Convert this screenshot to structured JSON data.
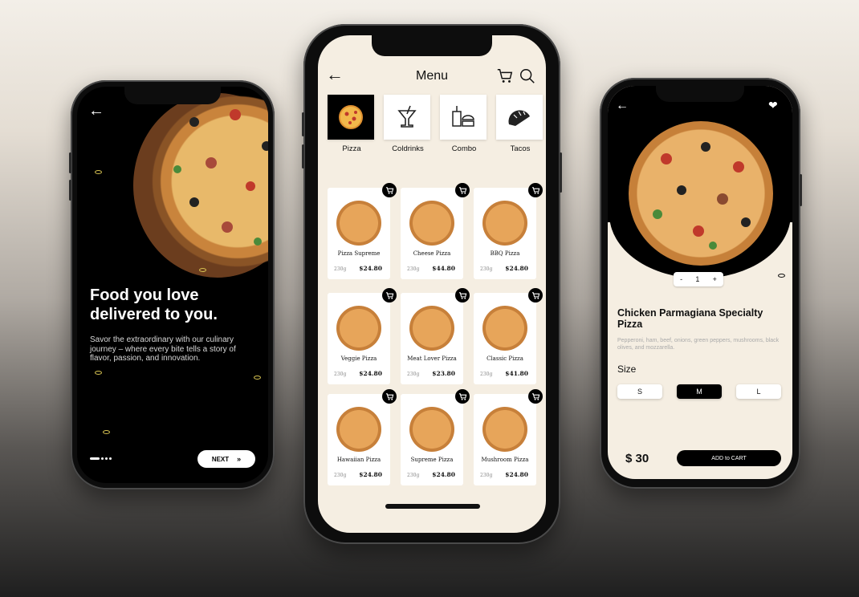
{
  "colors": {
    "accent": "#000000",
    "cream": "#f5eee2",
    "ring": "#d4c050"
  },
  "onboarding": {
    "back_icon": "arrow-left-icon",
    "title": "Food you love delivered to you.",
    "description": "Savor the extraordinary with our culinary journey – where every bite tells a story of flavor, passion, and innovation.",
    "next_label": "NEXT",
    "next_icon": "double-chevron-right-icon"
  },
  "menu": {
    "title": "Menu",
    "categories": [
      {
        "label": "Pizza",
        "icon": "pizza-icon",
        "active": true
      },
      {
        "label": "Coldrinks",
        "icon": "drink-icon",
        "active": false
      },
      {
        "label": "Combo",
        "icon": "combo-icon",
        "active": false
      },
      {
        "label": "Tacos",
        "icon": "taco-icon",
        "active": false
      }
    ],
    "items": [
      {
        "name": "Pizza Supreme",
        "weight": "230g",
        "price": "$24.80"
      },
      {
        "name": "Cheese Pizza",
        "weight": "230g",
        "price": "$44.80"
      },
      {
        "name": "BBQ Pizza",
        "weight": "230g",
        "price": "$24.80"
      },
      {
        "name": "Veggie Pizza",
        "weight": "230g",
        "price": "$24.80"
      },
      {
        "name": "Meat Lover Pizza",
        "weight": "230g",
        "price": "$23.80"
      },
      {
        "name": "Classic Pizza",
        "weight": "230g",
        "price": "$41.80"
      },
      {
        "name": "Hawaiian Pizza",
        "weight": "230g",
        "price": "$24.80"
      },
      {
        "name": "Supreme Pizza",
        "weight": "230g",
        "price": "$24.80"
      },
      {
        "name": "Mushroom Pizza",
        "weight": "230g",
        "price": "$24.80"
      }
    ]
  },
  "detail": {
    "quantity": "1",
    "minus": "-",
    "plus": "+",
    "title": "Chicken Parmagiana Specialty Pizza",
    "description": "Pepperoni, ham, beef, onions, green peppers, mushrooms, black olives, and mozzarella.",
    "size_label": "Size",
    "sizes": [
      {
        "label": "S",
        "selected": false
      },
      {
        "label": "M",
        "selected": true
      },
      {
        "label": "L",
        "selected": false
      }
    ],
    "price": "$ 30",
    "add_to_cart": "ADD to CART"
  }
}
